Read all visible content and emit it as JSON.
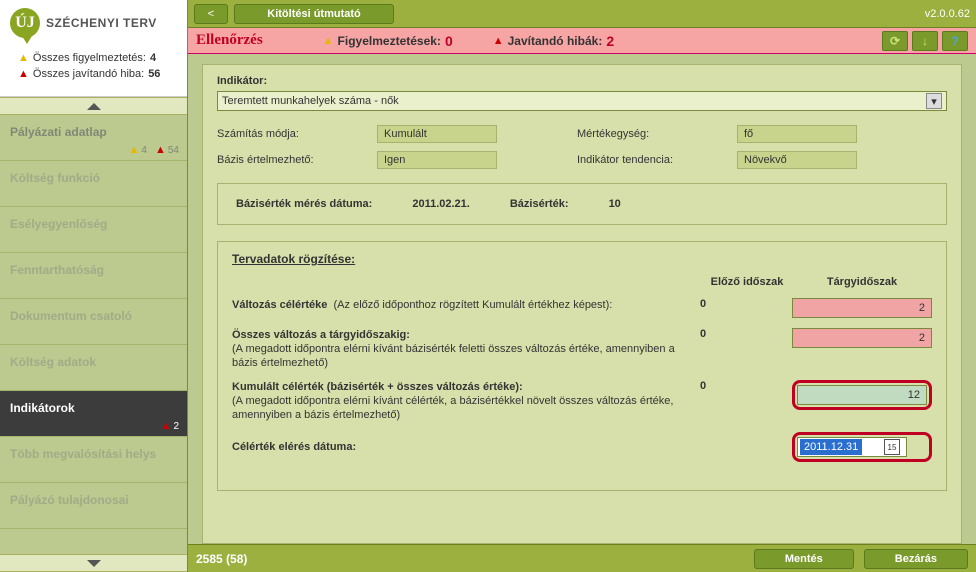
{
  "logo": {
    "icon": "ÚJ",
    "text": "SZÉCHENYI TERV"
  },
  "summary": {
    "warn_label": "Összes figyelmeztetés:",
    "warn_count": "4",
    "err_label": "Összes javítandó hiba:",
    "err_count": "56"
  },
  "nav": {
    "items": [
      {
        "label": "Pályázati adatlap",
        "warn": "4",
        "err": "54"
      },
      {
        "label": "Költség funkció"
      },
      {
        "label": "Esélyegyenlőség"
      },
      {
        "label": "Fenntarthatóság"
      },
      {
        "label": "Dokumentum csatoló"
      },
      {
        "label": "Költség adatok"
      },
      {
        "label": "Indikátorok",
        "err": "2",
        "active": true
      },
      {
        "label": "Több megvalósítási helys"
      },
      {
        "label": "Pályázó tulajdonosai"
      }
    ]
  },
  "topbar": {
    "guide": "Kitöltési útmutató",
    "version": "v2.0.0.62"
  },
  "valbar": {
    "title": "Ellenőrzés",
    "warn_label": "Figyelmeztetések:",
    "warn_count": "0",
    "err_label": "Javítandó hibák:",
    "err_count": "2"
  },
  "indicator": {
    "label": "Indikátor:",
    "value": "Teremtett munkahelyek száma - nők",
    "calc_label": "Számítás módja:",
    "calc_value": "Kumulált",
    "unit_label": "Mértékegység:",
    "unit_value": "fő",
    "base_label": "Bázis értelmezhető:",
    "base_value": "Igen",
    "trend_label": "Indikátor tendencia:",
    "trend_value": "Növekvő"
  },
  "base": {
    "date_label": "Bázisérték mérés dátuma:",
    "date_value": "2011.02.21.",
    "val_label": "Bázisérték:",
    "val_value": "10"
  },
  "plan": {
    "title": "Tervadatok rögzítése:",
    "col_prev": "Előző időszak",
    "col_curr": "Tárgyidőszak",
    "row1_title": "Változás célértéke",
    "row1_note": "(Az előző időponthoz rögzített Kumulált értékhez képest):",
    "row1_prev": "0",
    "row1_curr": "2",
    "row2_title": "Összes változás a tárgyidőszakig:",
    "row2_note": "(A megadott időpontra elérni kívánt bázisérték feletti összes változás értéke, amennyiben a bázis értelmezhető)",
    "row2_prev": "0",
    "row2_curr": "2",
    "row3_title": "Kumulált célérték (bázisérték + összes változás értéke):",
    "row3_note": "(A megadott időpontra elérni kívánt célérték, a bázisértékkel növelt összes változás értéke, amennyiben a bázis értelmezhető)",
    "row3_prev": "0",
    "row3_curr": "12",
    "row4_title": "Célérték elérés dátuma:",
    "row4_curr": "2011.12.31"
  },
  "footer": {
    "status": "2585 (58)",
    "save": "Mentés",
    "close": "Bezárás"
  }
}
